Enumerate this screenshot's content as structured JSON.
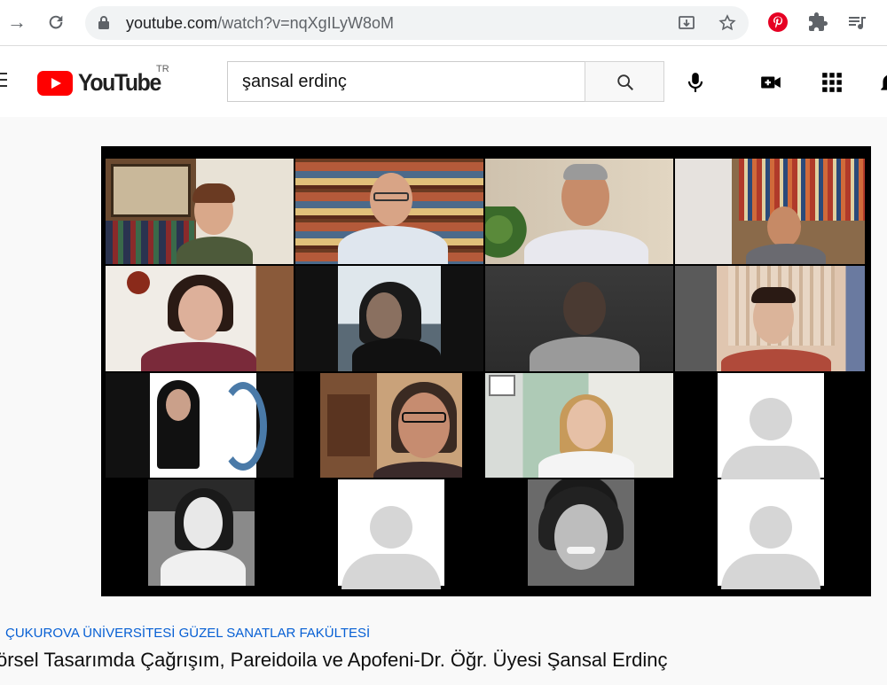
{
  "browser": {
    "url_host": "youtube.com",
    "url_path": "/watch?v=nqXgILyW8oM"
  },
  "youtube": {
    "logo_text": "YouTube",
    "region": "TR",
    "search_query": "şansal erdinç"
  },
  "video": {
    "channel": "ÇUKUROVA ÜNİVERSİTESİ GÜZEL SANATLAR FAKÜLTESİ",
    "title": "örsel Tasarımda Çağrışım, Pareidoila ve Apofeni-Dr. Öğr. Üyesi Şansal Erdinç"
  },
  "colors": {
    "accent": "#ff0000",
    "link": "#065fd4",
    "pinterest": "#e60023"
  }
}
